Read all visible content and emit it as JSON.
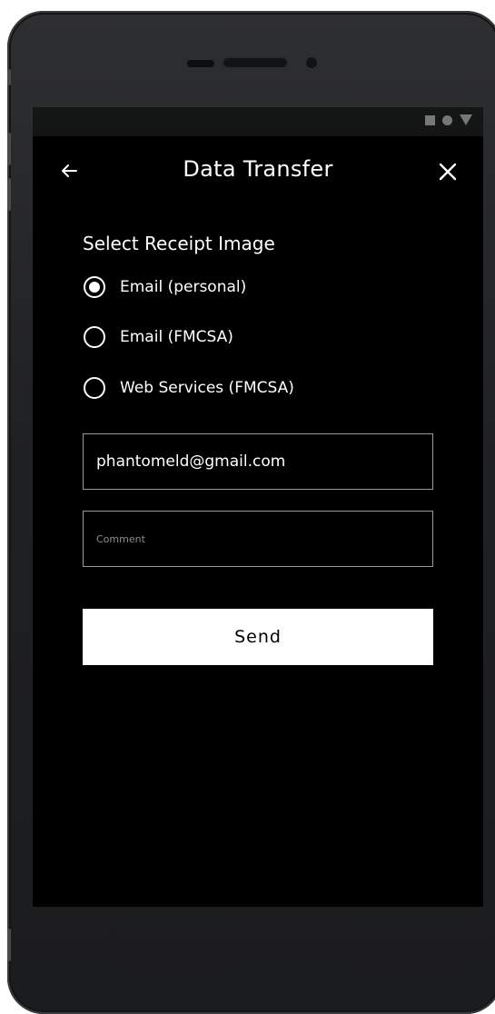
{
  "header": {
    "title": "Data Transfer",
    "back_icon": "arrow-left-icon",
    "close_icon": "close-icon"
  },
  "form": {
    "section_label": "Select Receipt Image",
    "options": [
      {
        "label": "Email (personal)",
        "selected": true
      },
      {
        "label": "Email (FMCSA)",
        "selected": false
      },
      {
        "label": "Web Services (FMCSA)",
        "selected": false
      }
    ],
    "email_value": "phantomeld@gmail.com",
    "comment_placeholder": "Comment",
    "send_label": "Send"
  },
  "colors": {
    "screen_bg": "#000000",
    "text": "#ffffff",
    "button_bg": "#ffffff",
    "button_text": "#000000"
  }
}
